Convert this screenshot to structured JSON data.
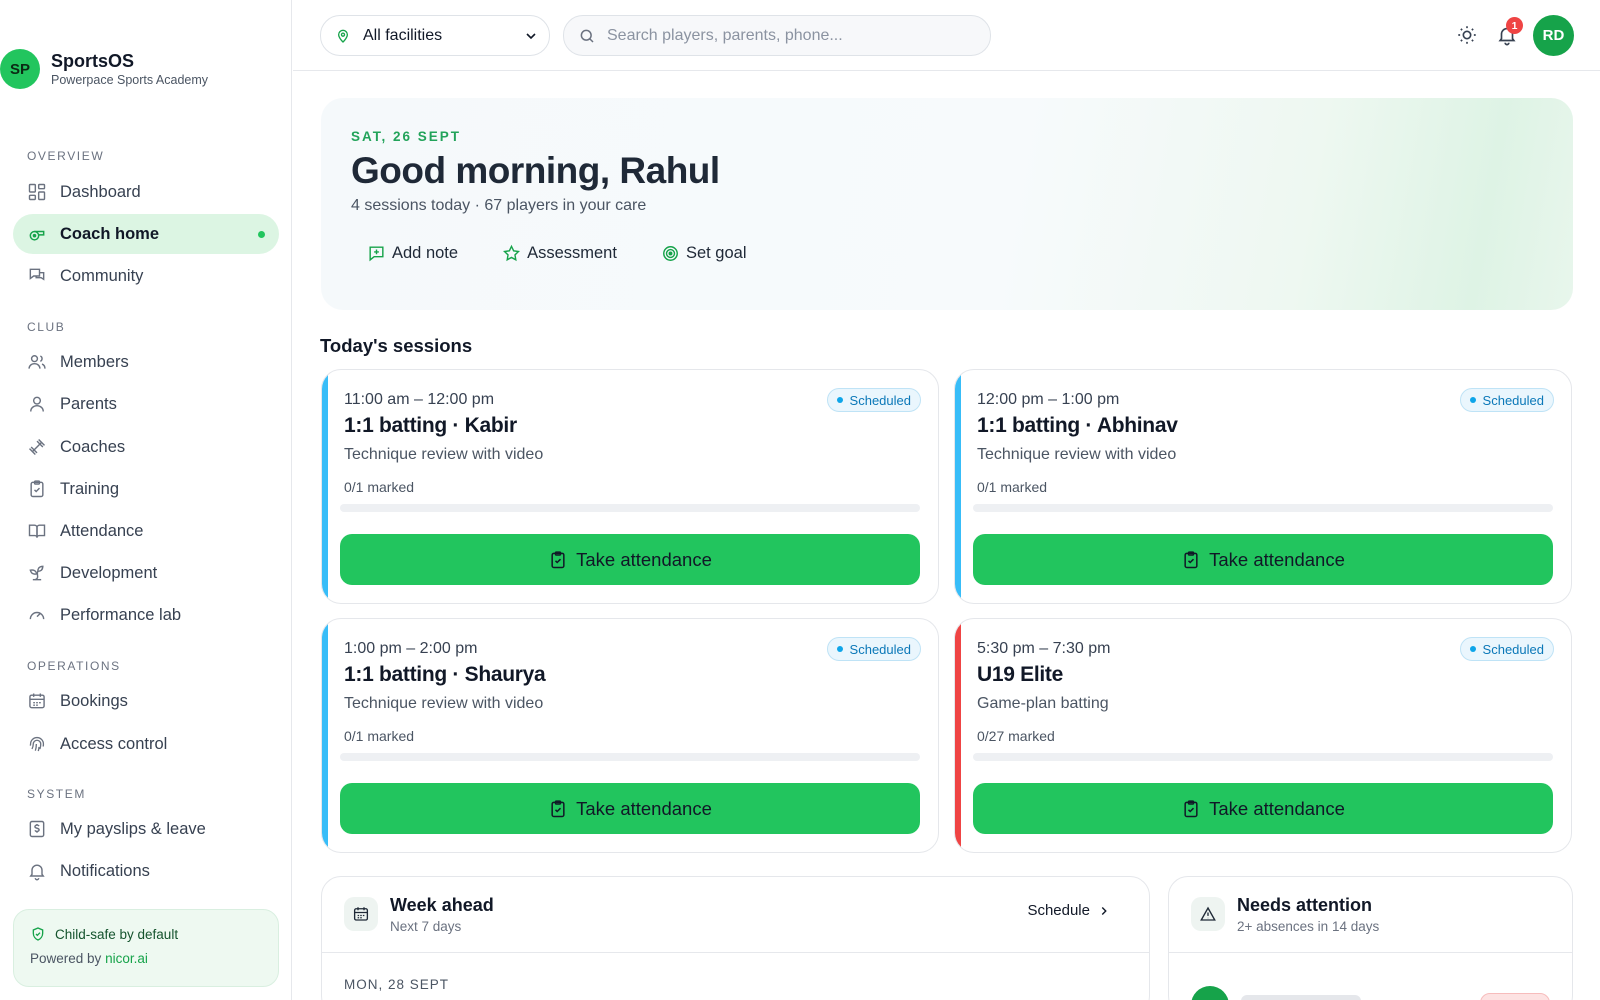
{
  "brand": {
    "initials": "SP",
    "name": "SportsOS",
    "subtitle": "Powerpace Sports Academy"
  },
  "sidebar": {
    "sections": {
      "overview": "OVERVIEW",
      "club": "CLUB",
      "operations": "OPERATIONS",
      "system": "SYSTEM"
    },
    "items": [
      {
        "label": "Dashboard",
        "icon": "dashboard-icon"
      },
      {
        "label": "Coach home",
        "icon": "whistle-icon",
        "active": true
      },
      {
        "label": "Community",
        "icon": "chat-icon"
      },
      {
        "label": "Members",
        "icon": "users-icon"
      },
      {
        "label": "Parents",
        "icon": "user-icon"
      },
      {
        "label": "Coaches",
        "icon": "dumbbell-icon"
      },
      {
        "label": "Training",
        "icon": "clipboard-icon"
      },
      {
        "label": "Attendance",
        "icon": "book-icon"
      },
      {
        "label": "Development",
        "icon": "sprout-icon"
      },
      {
        "label": "Performance lab",
        "icon": "gauge-icon"
      },
      {
        "label": "Bookings",
        "icon": "calendar-icon"
      },
      {
        "label": "Access control",
        "icon": "fingerprint-icon"
      },
      {
        "label": "My payslips & leave",
        "icon": "receipt-icon"
      },
      {
        "label": "Notifications",
        "icon": "bell-icon"
      }
    ],
    "footer": {
      "title": "Child-safe by default",
      "powered_prefix": "Powered by",
      "powered_link": "nicor.ai"
    }
  },
  "topbar": {
    "facility": "All facilities",
    "search_placeholder": "Search players, parents, phone...",
    "notification_count": "1",
    "user_initials": "RD"
  },
  "hero": {
    "date": "SAT, 26 SEPT",
    "greeting": "Good morning, Rahul",
    "summary": "4 sessions today · 67 players in your care",
    "actions": {
      "add_note": "Add note",
      "assessment": "Assessment",
      "set_goal": "Set goal"
    }
  },
  "sessions": {
    "title": "Today's sessions",
    "items": [
      {
        "time": "11:00 am – 12:00 pm",
        "title": "1:1 batting · Kabir",
        "description": "Technique review with video",
        "marked": "0/1 marked",
        "progress": 0,
        "status": "Scheduled",
        "accent": "#38bdf8",
        "button": "Take attendance"
      },
      {
        "time": "12:00 pm – 1:00 pm",
        "title": "1:1 batting · Abhinav",
        "description": "Technique review with video",
        "marked": "0/1 marked",
        "progress": 0,
        "status": "Scheduled",
        "accent": "#38bdf8",
        "button": "Take attendance"
      },
      {
        "time": "1:00 pm – 2:00 pm",
        "title": "1:1 batting · Shaurya",
        "description": "Technique review with video",
        "marked": "0/1 marked",
        "progress": 0,
        "status": "Scheduled",
        "accent": "#38bdf8",
        "button": "Take attendance"
      },
      {
        "time": "5:30 pm – 7:30 pm",
        "title": "U19 Elite",
        "description": "Game-plan batting",
        "marked": "0/27 marked",
        "progress": 0,
        "status": "Scheduled",
        "accent": "#ef4444",
        "button": "Take attendance"
      }
    ]
  },
  "week_ahead": {
    "title": "Week ahead",
    "subtitle": "Next 7 days",
    "link": "Schedule",
    "first_day": "MON, 28 SEPT"
  },
  "needs_attention": {
    "title": "Needs attention",
    "subtitle": "2+ absences in 14 days"
  },
  "colors": {
    "accent": "#22c55e",
    "accent_dark": "#16a34a",
    "scheduled_badge": "#0b78b8",
    "alert": "#ef4444"
  }
}
